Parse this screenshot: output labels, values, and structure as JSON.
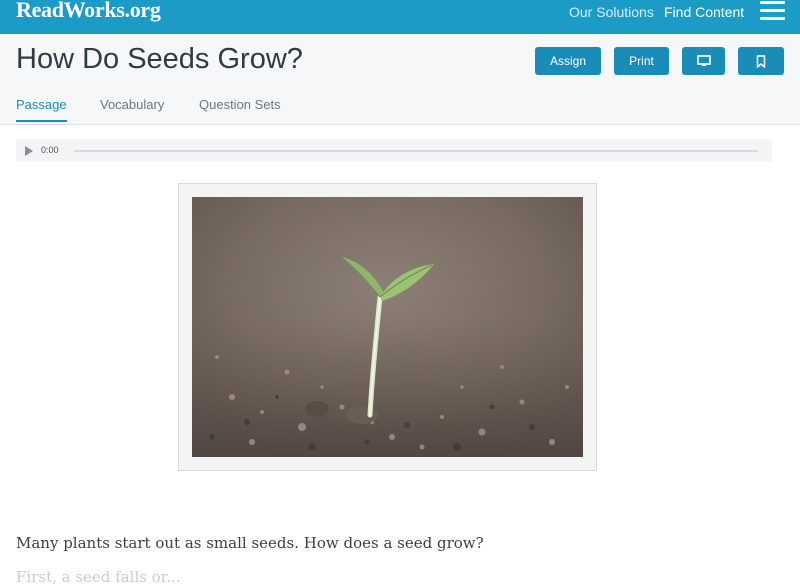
{
  "topbar": {
    "logo": "ReadWorks.org",
    "nav": [
      "Our Solutions",
      "Find Content"
    ],
    "menu_icon": "hamburger-menu-icon",
    "color": "#1d9bc7"
  },
  "header": {
    "title": "How Do Seeds Grow?",
    "buttons": {
      "assign": "Assign",
      "print": "Print",
      "present_icon": "monitor-icon",
      "bookmark_icon": "bookmark-icon"
    },
    "tabs": [
      "Passage",
      "Vocabulary",
      "Question Sets"
    ],
    "active_tab": "Passage",
    "accent": "#1a8cb8"
  },
  "audio": {
    "time": "0:00",
    "icon": "play-icon"
  },
  "image": {
    "subject": "seedling-photo"
  },
  "passage": {
    "line1": "Many plants start out as small seeds. How does a seed grow?",
    "line2": "First, a seed falls or..."
  }
}
